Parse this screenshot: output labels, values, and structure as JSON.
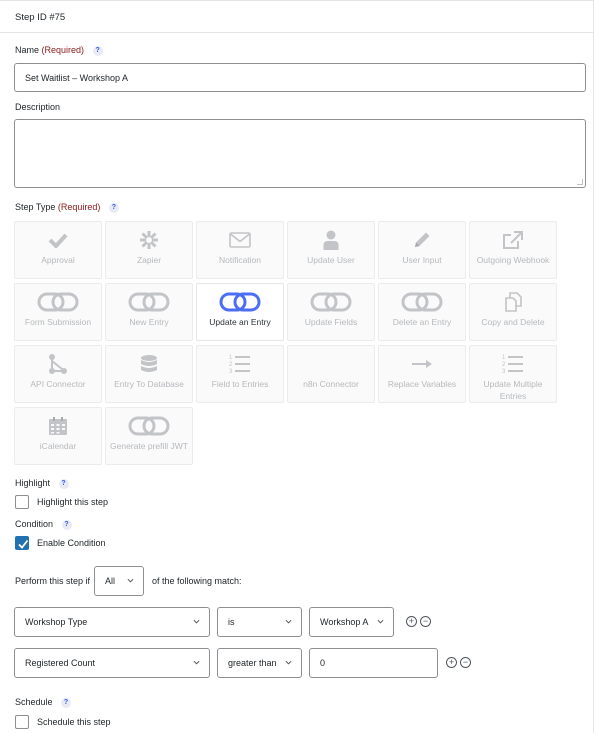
{
  "header": {
    "step_id": "Step ID #75"
  },
  "name": {
    "label": "Name",
    "required": "(Required)",
    "value": "Set Waitlist – Workshop A"
  },
  "description": {
    "label": "Description",
    "value": ""
  },
  "step_type": {
    "label": "Step Type",
    "required": "(Required)",
    "tiles": [
      {
        "label": "Approval",
        "icon": "check-icon"
      },
      {
        "label": "Zapier",
        "icon": "zapier-icon"
      },
      {
        "label": "Notification",
        "icon": "envelope-icon"
      },
      {
        "label": "Update User",
        "icon": "user-icon"
      },
      {
        "label": "User Input",
        "icon": "pencil-icon"
      },
      {
        "label": "Outgoing Webhook",
        "icon": "external-link-icon"
      },
      {
        "label": "Form Submission",
        "icon": "link-icon"
      },
      {
        "label": "New Entry",
        "icon": "link-icon"
      },
      {
        "label": "Update an Entry",
        "icon": "link-icon",
        "selected": true
      },
      {
        "label": "Update Fields",
        "icon": "link-icon"
      },
      {
        "label": "Delete an Entry",
        "icon": "link-icon"
      },
      {
        "label": "Copy and Delete",
        "icon": "copy-icon"
      },
      {
        "label": "API Connector",
        "icon": "connector-icon"
      },
      {
        "label": "Entry To Database",
        "icon": "database-icon"
      },
      {
        "label": "Field to Entries",
        "icon": "numbered-list-icon"
      },
      {
        "label": "n8n Connector",
        "icon": "none"
      },
      {
        "label": "Replace Variables",
        "icon": "arrow-right-icon"
      },
      {
        "label": "Update Multiple Entries",
        "icon": "numbered-list-icon"
      },
      {
        "label": "iCalendar",
        "icon": "calendar-icon"
      },
      {
        "label": "Generate prefill JWT",
        "icon": "link-icon"
      }
    ]
  },
  "highlight": {
    "label": "Highlight",
    "checkbox_label": "Highlight this step",
    "checked": false
  },
  "condition": {
    "label": "Condition",
    "checkbox_label": "Enable Condition",
    "checked": true,
    "perform_prefix": "Perform this step if",
    "match_value": "All",
    "perform_suffix": "of the following match:",
    "rules": [
      {
        "field": "Workshop Type",
        "operator": "is",
        "value": "Workshop A"
      },
      {
        "field": "Registered Count",
        "operator": "greater than",
        "value": "0"
      }
    ],
    "add_symbol": "+",
    "remove_symbol": "−"
  },
  "schedule": {
    "label": "Schedule",
    "checkbox_label": "Schedule this step",
    "checked": false
  },
  "help_symbol": "?",
  "colors": {
    "accent": "#2271b1",
    "required": "#8b1a1a",
    "selected_icon": "#4c6ef5",
    "tile_icon": "#c3c4c7"
  }
}
